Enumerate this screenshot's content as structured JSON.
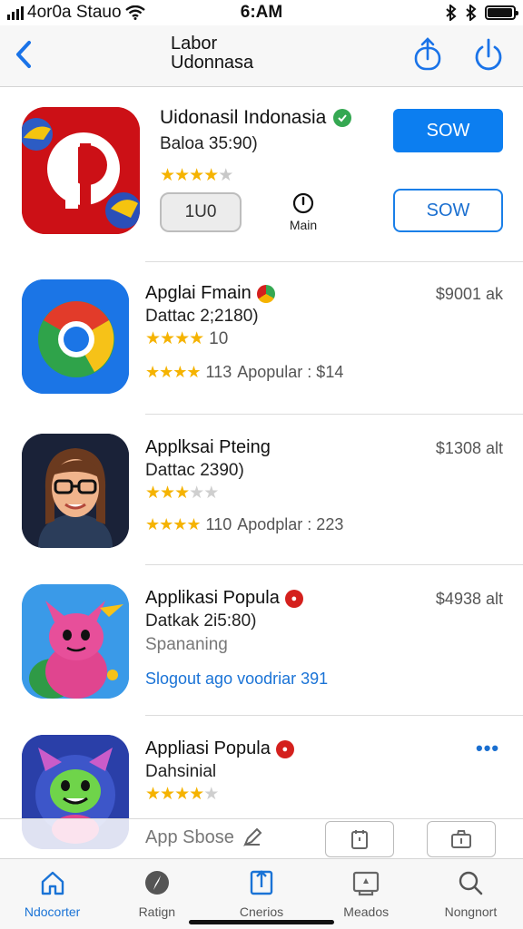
{
  "status_bar": {
    "carrier": "4or0a Stauo",
    "time": "6:AM",
    "battery_level": 0.95
  },
  "nav": {
    "title_line1": "Labor",
    "title_line2": "Udonnasa",
    "back_icon": "chevron-left-icon",
    "share_icon": "share-icon",
    "refresh_icon": "refresh-icon"
  },
  "featured": {
    "name": "Uidonasil Indonasia",
    "subtitle": "Baloa 35:90)",
    "rating": 4.5,
    "stars": "★★★★★",
    "pill_label": "1U0",
    "main_label": "Main",
    "primary_button": "SOW",
    "secondary_button": "SOW",
    "accent": "#0c7ef0",
    "icon_color": "#cc1016"
  },
  "apps": [
    {
      "name": "Apglai Fmain",
      "subtitle": "Dattac 2;2180)",
      "rating_count": "10",
      "stars_top": "★★★★",
      "stars_bottom": "★★★★",
      "meta_count": "113",
      "meta_text": "Apopular : $14",
      "price": "$9001 ak",
      "badge": "multi",
      "icon": "chrome-like-icon"
    },
    {
      "name": "Applksai Pteing",
      "subtitle": "Dattac 2390)",
      "rating_count": "",
      "stars_top": "★★★★★",
      "stars_bottom": "★★★★",
      "meta_count": "110",
      "meta_text": "Apodplar : 223",
      "price": "$1308 alt",
      "badge": "none",
      "icon": "avatar-woman-icon"
    },
    {
      "name": "Applikasi Popula",
      "subtitle": "Datkak 2i5:80)",
      "extra": "Spananing",
      "link_text": "Slogout ago voodriar 391",
      "price": "$4938 alt",
      "badge": "red",
      "icon": "pink-creature-icon"
    },
    {
      "name": "Appliasi Popula",
      "subtitle": "Dahsinial",
      "stars_top": "★★★★★",
      "badge": "red",
      "icon": "green-creature-icon"
    }
  ],
  "overlay": {
    "label": "App Sbose"
  },
  "tabs": [
    {
      "label": "Ndocorter",
      "icon": "home-icon",
      "active": true
    },
    {
      "label": "Ratign",
      "icon": "compass-icon",
      "active": false
    },
    {
      "label": "Cnerios",
      "icon": "bookmark-icon",
      "active": false
    },
    {
      "label": "Meados",
      "icon": "inbox-icon",
      "active": false
    },
    {
      "label": "Nongnort",
      "icon": "search-icon",
      "active": false
    }
  ]
}
